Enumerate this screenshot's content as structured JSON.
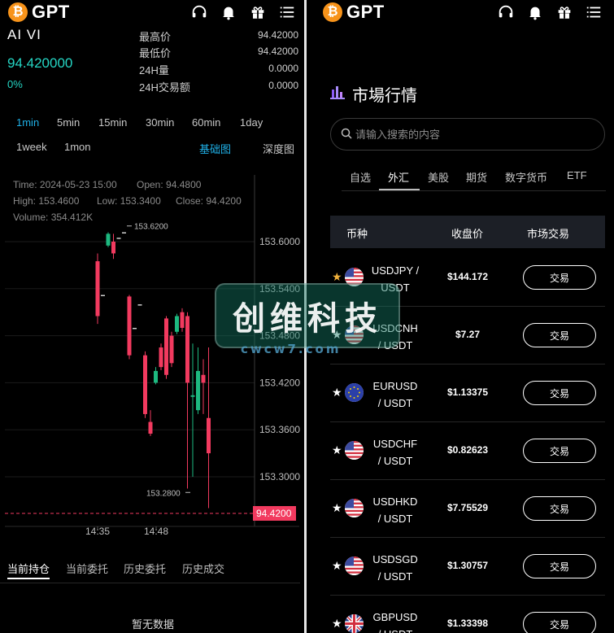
{
  "brand": {
    "logo_text": "GPT",
    "btc_symbol": "₿"
  },
  "header_icons": [
    "headset-icon",
    "bell-icon",
    "gift-icon",
    "menu-icon"
  ],
  "left": {
    "symbol": "AI VI",
    "price": "94.420000",
    "change_pct": "0%",
    "stats": [
      {
        "label": "最高价",
        "value": "94.42000"
      },
      {
        "label": "最低价",
        "value": "94.42000"
      },
      {
        "label": "24H量",
        "value": "0.0000"
      },
      {
        "label": "24H交易额",
        "value": "0.0000"
      }
    ],
    "timeframes": [
      "1min",
      "5min",
      "15min",
      "30min",
      "60min",
      "1day",
      "1week",
      "1mon"
    ],
    "active_timeframe": "1min",
    "view_tabs": [
      "基础图",
      "深度图"
    ],
    "active_view": "基础图",
    "ohlc": {
      "time_label": "Time:",
      "time": "2024-05-23 15:00",
      "open_label": "Open:",
      "open": "94.4800",
      "high_label": "High:",
      "high": "153.4600",
      "low_label": "Low:",
      "low": "153.3400",
      "close_label": "Close:",
      "close": "94.4200",
      "volume_label": "Volume:",
      "volume": "354.412K"
    },
    "position_tabs": [
      "当前持仓",
      "当前委托",
      "历史委托",
      "历史成交"
    ],
    "active_position_tab": "当前持仓",
    "empty_text": "暂无数据"
  },
  "chart_data": {
    "type": "candlestick",
    "y_ticks": [
      153.6,
      153.54,
      153.48,
      153.42,
      153.36,
      153.3
    ],
    "y_tick_labels": [
      "153.6000",
      "153.5400",
      "153.4800",
      "153.4200",
      "153.3600",
      "153.3000"
    ],
    "x_ticks": [
      "14:35",
      "14:48"
    ],
    "max_label": "153.6200",
    "min_label": "153.2800",
    "current_price_label": "94.4200",
    "colors": {
      "up": "#1db980",
      "down": "#f23a5f",
      "current_line": "#f23a5f"
    },
    "candles": [
      {
        "o": 153.575,
        "c": 153.505,
        "h": 153.585,
        "l": 153.495
      },
      {
        "o": 153.532,
        "c": 153.532,
        "h": 153.532,
        "l": 153.532
      },
      {
        "o": 153.595,
        "c": 153.61,
        "h": 153.612,
        "l": 153.593
      },
      {
        "o": 153.6,
        "c": 153.585,
        "h": 153.61,
        "l": 153.578
      },
      {
        "o": 153.605,
        "c": 153.605,
        "h": 153.605,
        "l": 153.605
      },
      {
        "o": 153.612,
        "c": 153.612,
        "h": 153.612,
        "l": 153.612
      },
      {
        "o": 153.53,
        "c": 153.455,
        "h": 153.532,
        "l": 153.45
      },
      {
        "o": 153.49,
        "c": 153.49,
        "h": 153.49,
        "l": 153.49
      },
      {
        "o": 153.52,
        "c": 153.52,
        "h": 153.52,
        "l": 153.52
      },
      {
        "o": 153.455,
        "c": 153.38,
        "h": 153.46,
        "l": 153.375
      },
      {
        "o": 153.37,
        "c": 153.355,
        "h": 153.385,
        "l": 153.352
      },
      {
        "o": 153.42,
        "c": 153.435,
        "h": 153.44,
        "l": 153.418
      },
      {
        "o": 153.465,
        "c": 153.44,
        "h": 153.47,
        "l": 153.436
      },
      {
        "o": 153.502,
        "c": 153.43,
        "h": 153.505,
        "l": 153.425
      },
      {
        "o": 153.48,
        "c": 153.445,
        "h": 153.485,
        "l": 153.44
      },
      {
        "o": 153.485,
        "c": 153.505,
        "h": 153.508,
        "l": 153.482
      },
      {
        "o": 153.51,
        "c": 153.49,
        "h": 153.515,
        "l": 153.485
      },
      {
        "o": 153.505,
        "c": 153.42,
        "h": 153.51,
        "l": 153.285
      },
      {
        "o": 153.402,
        "c": 153.404,
        "h": 153.47,
        "l": 153.3
      },
      {
        "o": 153.385,
        "c": 153.435,
        "h": 153.465,
        "l": 153.38
      },
      {
        "o": 153.43,
        "c": 153.42,
        "h": 153.45,
        "l": 153.38
      },
      {
        "o": 153.375,
        "c": 153.33,
        "h": 153.465,
        "l": 153.26
      }
    ]
  },
  "right": {
    "title": "市場行情",
    "search_placeholder": "请输入搜索的内容",
    "category_tabs": [
      "自选",
      "外汇",
      "美股",
      "期货",
      "数字货币",
      "ETF"
    ],
    "active_category": "外汇",
    "table_headers": [
      "币种",
      "收盘价",
      "市场交易"
    ],
    "trade_label": "交易",
    "rows": [
      {
        "pair_line1": "USDJPY /",
        "pair_line2": "USDT",
        "close": "$144.172",
        "star_color": "#f1b13b",
        "flag": "us"
      },
      {
        "pair_line1": "USDCNH",
        "pair_line2": "/ USDT",
        "close": "$7.27",
        "star_color": "#ffffff",
        "flag": "us"
      },
      {
        "pair_line1": "EURUSD",
        "pair_line2": "/ USDT",
        "close": "$1.13375",
        "star_color": "#ffffff",
        "flag": "eu"
      },
      {
        "pair_line1": "USDCHF",
        "pair_line2": "/ USDT",
        "close": "$0.82623",
        "star_color": "#ffffff",
        "flag": "us"
      },
      {
        "pair_line1": "USDHKD",
        "pair_line2": "/ USDT",
        "close": "$7.75529",
        "star_color": "#ffffff",
        "flag": "us"
      },
      {
        "pair_line1": "USDSGD",
        "pair_line2": "/ USDT",
        "close": "$1.30757",
        "star_color": "#ffffff",
        "flag": "us"
      },
      {
        "pair_line1": "GBPUSD",
        "pair_line2": "/ USDT",
        "close": "$1.33398",
        "star_color": "#ffffff",
        "flag": "uk"
      }
    ]
  },
  "watermark": {
    "main": "创维科技",
    "sub": "cwcw7.com"
  }
}
